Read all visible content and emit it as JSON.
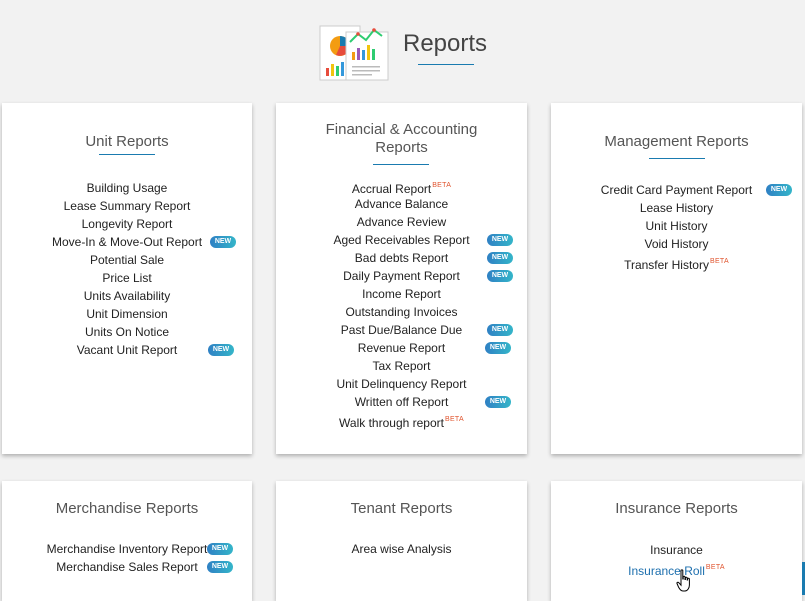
{
  "header": {
    "title": "Reports"
  },
  "cards": {
    "unit": {
      "title": "Unit Reports",
      "items": [
        {
          "label": "Building Usage"
        },
        {
          "label": "Lease Summary Report"
        },
        {
          "label": "Longevity Report"
        },
        {
          "label": "Move-In & Move-Out Report",
          "badge": "NEW"
        },
        {
          "label": "Potential Sale"
        },
        {
          "label": "Price List"
        },
        {
          "label": "Units Availability"
        },
        {
          "label": "Unit Dimension"
        },
        {
          "label": "Units On Notice"
        },
        {
          "label": "Vacant Unit Report",
          "badge": "NEW"
        }
      ]
    },
    "financial": {
      "title_line1": "Financial & Accounting",
      "title_line2": "Reports",
      "items": [
        {
          "label": "Accrual Report",
          "beta": "BETA"
        },
        {
          "label": "Advance Balance"
        },
        {
          "label": "Advance Review"
        },
        {
          "label": "Aged Receivables Report",
          "badge": "NEW"
        },
        {
          "label": "Bad debts Report",
          "badge": "NEW"
        },
        {
          "label": "Daily Payment Report",
          "badge": "NEW"
        },
        {
          "label": "Income Report"
        },
        {
          "label": "Outstanding Invoices"
        },
        {
          "label": "Past Due/Balance Due",
          "badge": "NEW"
        },
        {
          "label": "Revenue Report",
          "badge": "NEW"
        },
        {
          "label": "Tax Report"
        },
        {
          "label": "Unit Delinquency Report"
        },
        {
          "label": "Written off Report",
          "badge": "NEW"
        },
        {
          "label": "Walk through report",
          "beta": "BETA"
        }
      ]
    },
    "management": {
      "title": "Management Reports",
      "items": [
        {
          "label": "Credit Card Payment Report",
          "badge": "NEW"
        },
        {
          "label": "Lease History"
        },
        {
          "label": "Unit History"
        },
        {
          "label": "Void History"
        },
        {
          "label": "Transfer History",
          "beta": "BETA"
        }
      ]
    },
    "merchandise": {
      "title": "Merchandise Reports",
      "items": [
        {
          "label": "Merchandise Inventory Report",
          "badge": "NEW"
        },
        {
          "label": "Merchandise Sales Report",
          "badge": "NEW"
        }
      ]
    },
    "tenant": {
      "title": "Tenant Reports",
      "items": [
        {
          "label": "Area wise Analysis"
        }
      ]
    },
    "insurance": {
      "title": "Insurance Reports",
      "items": [
        {
          "label": "Insurance"
        },
        {
          "label": "Insurance Roll",
          "beta": "BETA",
          "hovered": true
        }
      ]
    }
  },
  "icons": {
    "logo": "reports-illustration-icon",
    "cursor": "hand-pointer-cursor-icon"
  },
  "colors": {
    "accent": "#1a7bb0",
    "beta": "#e0542e",
    "badge_start": "#2f80c4",
    "badge_end": "#34b5c9",
    "link": "#1d6fae"
  }
}
